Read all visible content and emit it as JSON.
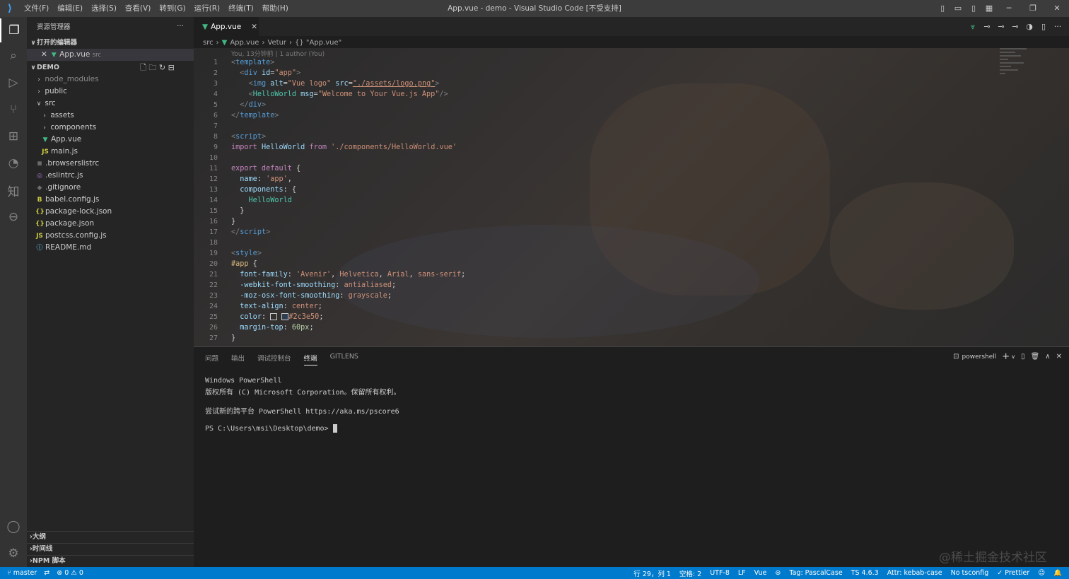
{
  "titlebar": {
    "menu": [
      "文件(F)",
      "编辑(E)",
      "选择(S)",
      "查看(V)",
      "转到(G)",
      "运行(R)",
      "终端(T)",
      "帮助(H)"
    ],
    "title": "App.vue - demo - Visual Studio Code [不受支持]"
  },
  "sidebar": {
    "header": "资源管理器",
    "more": "···",
    "open_editors": "打开的编辑器",
    "open_file": "App.vue",
    "open_file_dir": "src",
    "folder": "DEMO",
    "tree": [
      {
        "label": "node_modules",
        "muted": true
      },
      {
        "label": "public"
      },
      {
        "label": "src"
      },
      {
        "label": "assets"
      },
      {
        "label": "components"
      },
      {
        "label": "App.vue"
      },
      {
        "label": "main.js"
      },
      {
        "label": ".browserslistrc"
      },
      {
        "label": ".eslintrc.js"
      },
      {
        "label": ".gitignore"
      },
      {
        "label": "babel.config.js"
      },
      {
        "label": "package-lock.json"
      },
      {
        "label": "package.json"
      },
      {
        "label": "postcss.config.js"
      },
      {
        "label": "README.md"
      }
    ],
    "sections": [
      "大纲",
      "时间线",
      "NPM 脚本"
    ]
  },
  "tab": {
    "label": "App.vue"
  },
  "breadcrumb": {
    "a": "src",
    "b": "App.vue",
    "c": "Vetur",
    "d": "{} \"App.vue\""
  },
  "codelens": "You, 13分钟前 | 1 author (You)",
  "code_lines": [
    "1",
    "2",
    "3",
    "4",
    "5",
    "6",
    "7",
    "8",
    "9",
    "10",
    "11",
    "12",
    "13",
    "14",
    "15",
    "16",
    "17",
    "18",
    "19",
    "20",
    "21",
    "22",
    "23",
    "24",
    "25",
    "26",
    "27"
  ],
  "panel": {
    "tabs": [
      "问题",
      "输出",
      "调试控制台",
      "终端",
      "GITLENS"
    ],
    "shell": "powershell",
    "lines": [
      "Windows PowerShell",
      "版权所有 (C) Microsoft Corporation。保留所有权利。",
      "尝试新的跨平台 PowerShell https://aka.ms/pscore6",
      "PS C:\\Users\\msi\\Desktop\\demo> "
    ]
  },
  "watermark": "@稀土掘金技术社区",
  "status": {
    "branch": "master",
    "errors": "0",
    "warnings": "0",
    "position": "行 29，列 1",
    "spaces": "空格: 2",
    "encoding": "UTF-8",
    "eol": "LF",
    "lang": "Vue",
    "tag": "Tag: PascalCase",
    "ts": "TS 4.6.3",
    "attr": "Attr: kebab-case",
    "tsconfig": "No tsconfig",
    "prettier": "Prettier"
  }
}
